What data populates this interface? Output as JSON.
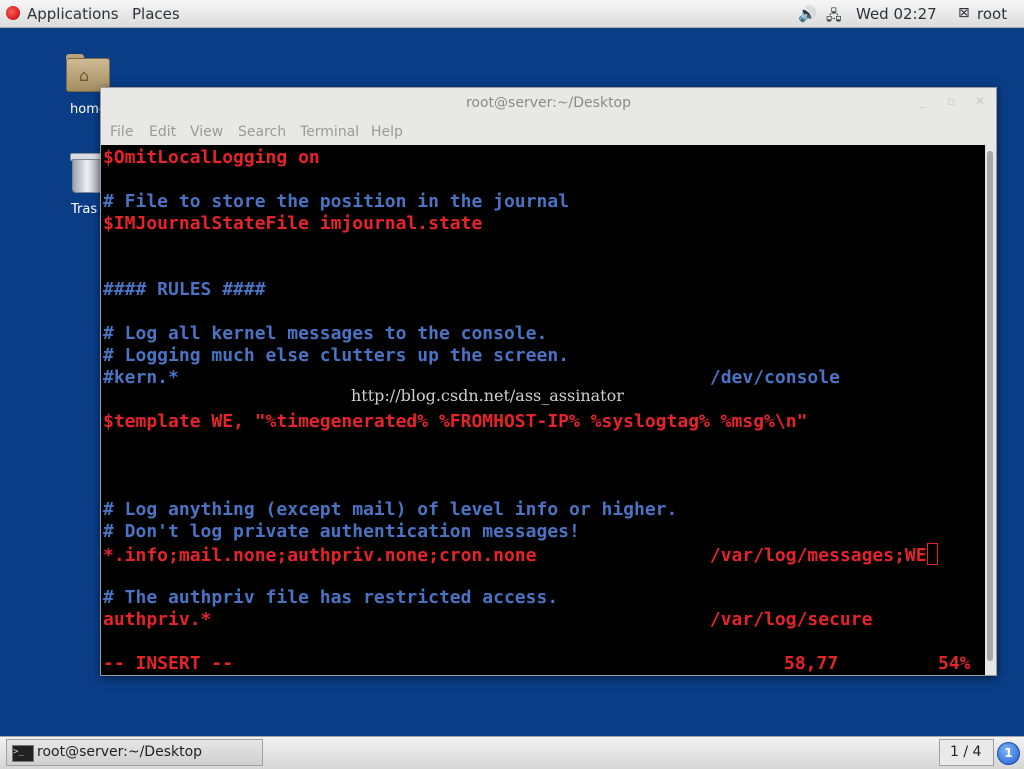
{
  "top_panel": {
    "applications_label": "Applications",
    "places_label": "Places",
    "clock": "Wed 02:27",
    "user": "root",
    "icons": [
      "redhat-logo-icon",
      "volume-icon",
      "network-icon",
      "user-icon"
    ]
  },
  "desktop": {
    "home_label": "home",
    "trash_label": "Tras"
  },
  "window": {
    "title": "root@server:~/Desktop",
    "menu": [
      "File",
      "Edit",
      "View",
      "Search",
      "Terminal",
      "Help"
    ]
  },
  "terminal": {
    "lines": [
      {
        "text": "$OmitLocalLogging on",
        "color": "red"
      },
      {
        "text": "# File to store the position in the journal",
        "color": "blue"
      },
      {
        "text": "$IMJournalStateFile imjournal.state",
        "color": "red"
      },
      {
        "text": "#### RULES ####",
        "color": "blue"
      },
      {
        "text": "# Log all kernel messages to the console.",
        "color": "blue"
      },
      {
        "text": "# Logging much else clutters up the screen.",
        "color": "blue"
      },
      {
        "text": "#kern.*                                                 /dev/console",
        "color": "blue"
      },
      {
        "text": "$template WE, \"%timegenerated% %FROMHOST-IP% %syslogtag% %msg%\\n\"",
        "color": "red"
      },
      {
        "text": "# Log anything (except mail) of level info or higher.",
        "color": "blue"
      },
      {
        "text": "# Don't log private authentication messages!",
        "color": "blue"
      },
      {
        "text": "*.info;mail.none;authpriv.none;cron.none                /var/log/messages;WE",
        "color": "red"
      },
      {
        "text": "# The authpriv file has restricted access.",
        "color": "blue"
      },
      {
        "text": "authpriv.*                                              /var/log/secure",
        "color": "red"
      }
    ],
    "status_mode": "-- INSERT --",
    "status_position": "58,77",
    "status_percent": "54%",
    "watermark": "http://blog.csdn.net/ass_assinator"
  },
  "bottom_panel": {
    "task_label": "root@server:~/Desktop",
    "workspace": "1 / 4",
    "notification_count": "1"
  }
}
